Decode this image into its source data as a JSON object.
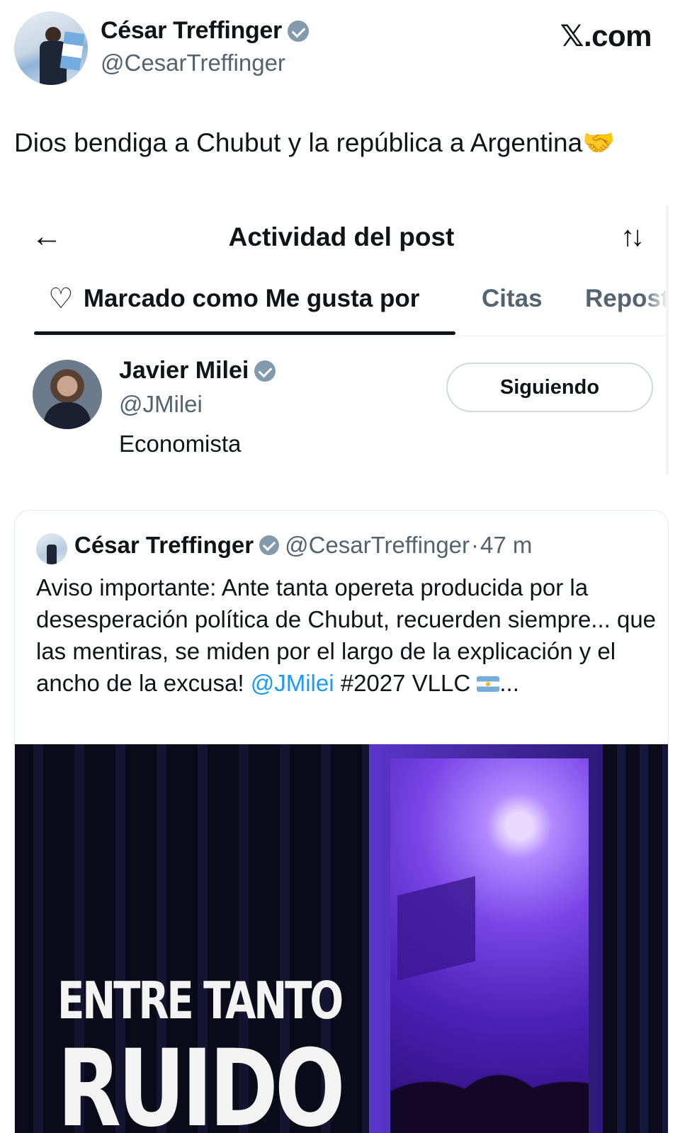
{
  "header": {
    "author_name": "César Treffinger",
    "author_handle": "@CesarTreffinger",
    "site": "𝕏.com",
    "verified_icon": "verified-badge-icon"
  },
  "tweet": {
    "text": "Dios bendiga a Chubut y la república a Argentina🤝"
  },
  "activity": {
    "title": "Actividad del post",
    "back_icon": "arrow-left-icon",
    "sort_icon": "sort-arrows-icon",
    "tabs": [
      {
        "label": "Marcado como Me gusta por",
        "icon": "heart-icon",
        "active": true
      },
      {
        "label": "Citas",
        "active": false
      },
      {
        "label": "Repost",
        "active": false
      }
    ],
    "user": {
      "name": "Javier Milei",
      "handle": "@JMilei",
      "bio": "Economista",
      "follow_label": "Siguiendo"
    }
  },
  "quoted": {
    "name": "César Treffinger",
    "handle": "@CesarTreffinger",
    "separator": "·",
    "time": "47 m",
    "text_before_mention": "Aviso importante: Ante tanta opereta producida por la desesperación política de Chubut, recuerden siempre... que las mentiras, se miden por el largo de la explicación y el ancho de la excusa! ",
    "mention": "@JMilei",
    "text_after_mention": "  #2027 VLLC ",
    "ellipsis": "...",
    "flag_icon": "argentina-flag-icon",
    "media": {
      "title_line1": "ENTRE TANTO",
      "title_line2": "RUIDO"
    }
  },
  "colors": {
    "text": "#0f1419",
    "secondary": "#536471",
    "link": "#1d9bf0",
    "border": "#cfd9de"
  }
}
